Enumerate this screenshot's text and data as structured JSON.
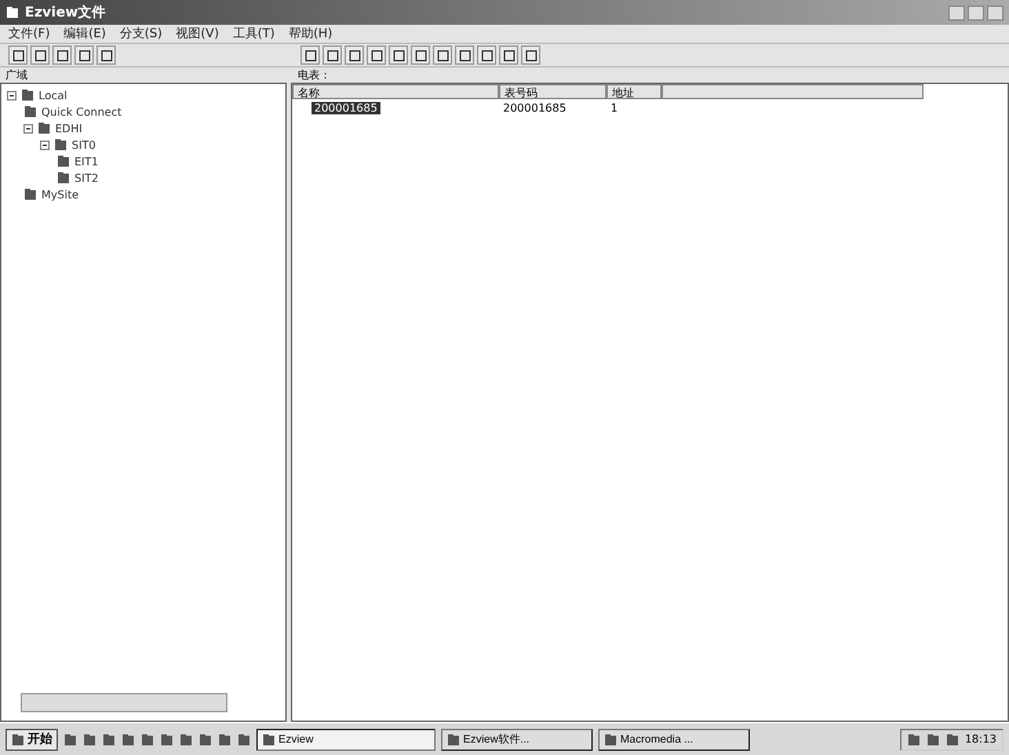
{
  "window": {
    "title": "Ezview文件"
  },
  "menu": [
    "文件(F)",
    "编辑(E)",
    "分支(S)",
    "视图(V)",
    "工具(T)",
    "帮助(H)"
  ],
  "left_pane": {
    "label": "广域",
    "tree": [
      {
        "label": "Local",
        "expanded": true,
        "children": [
          {
            "label": "Quick Connect"
          },
          {
            "label": "EDHI",
            "expanded": true,
            "children": [
              {
                "label": "SIT0",
                "expanded": true,
                "children": [
                  {
                    "label": "EIT1"
                  },
                  {
                    "label": "SIT2"
                  }
                ]
              }
            ]
          },
          {
            "label": "MySite"
          }
        ]
      }
    ]
  },
  "right_pane": {
    "label": "电表：",
    "columns": [
      "名称",
      "表号码",
      "地址"
    ],
    "rows": [
      {
        "cells": [
          "200001685",
          "200001685",
          "1"
        ],
        "selected": true
      }
    ]
  },
  "taskbar": {
    "start": "开始",
    "tasks": [
      {
        "label": "Ezview",
        "selected": true
      },
      {
        "label": "Ezview软件...",
        "selected": false
      },
      {
        "label": "Macromedia ...",
        "selected": false
      }
    ],
    "clock": "18:13"
  }
}
